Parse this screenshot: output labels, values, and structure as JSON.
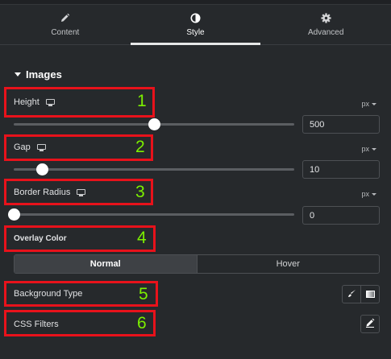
{
  "tabs": [
    {
      "label": "Content",
      "icon": "pencil-icon",
      "active": false
    },
    {
      "label": "Style",
      "icon": "half-circle-icon",
      "active": true
    },
    {
      "label": "Advanced",
      "icon": "gear-icon",
      "active": false
    }
  ],
  "section": {
    "title": "Images"
  },
  "controls": {
    "height": {
      "label": "Height",
      "unit": "px",
      "value": "500",
      "slider_fraction": 0.5
    },
    "gap": {
      "label": "Gap",
      "unit": "px",
      "value": "10",
      "slider_fraction": 0.1
    },
    "border_radius": {
      "label": "Border Radius",
      "unit": "px",
      "value": "0",
      "slider_fraction": 0.0
    },
    "overlay_color": {
      "label": "Overlay Color"
    },
    "state_tabs": {
      "normal": "Normal",
      "hover": "Hover"
    },
    "background_type": {
      "label": "Background Type"
    },
    "css_filters": {
      "label": "CSS Filters"
    }
  },
  "annotations": [
    "1",
    "2",
    "3",
    "4",
    "5",
    "6"
  ],
  "colors": {
    "highlight_box": "#e8121b",
    "annotation_number": "#7cf000",
    "panel_bg": "#26292c"
  }
}
